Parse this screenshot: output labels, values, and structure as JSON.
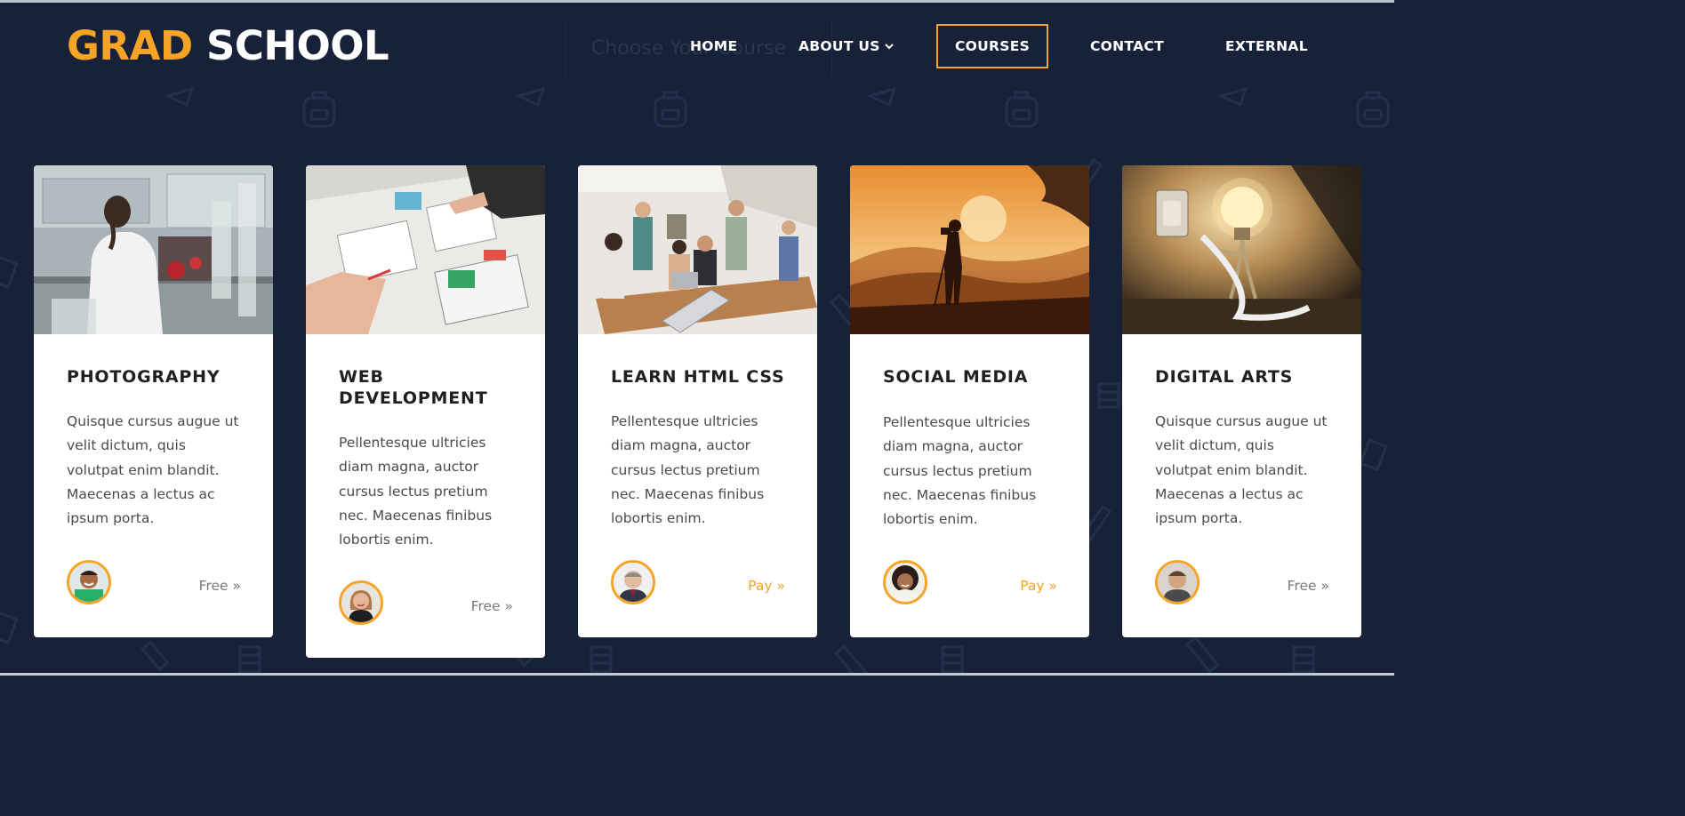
{
  "logo": {
    "accent": "GRAD",
    "rest": "SCHOOL"
  },
  "search": {
    "ghost_text": "Choose Your Course"
  },
  "nav": {
    "items": [
      {
        "label": "HOME",
        "active": false
      },
      {
        "label": "ABOUT US",
        "active": false,
        "dropdown": true
      },
      {
        "label": "COURSES",
        "active": true
      },
      {
        "label": "CONTACT",
        "active": false
      },
      {
        "label": "EXTERNAL",
        "active": false
      }
    ],
    "dropdown_icon": "chevron-down-icon"
  },
  "cards": [
    {
      "title": "PHOTOGRAPHY",
      "description": "Quisque cursus augue ut velit dictum, quis volutpat enim blandit. Maecenas a lectus ac ipsum porta.",
      "image": "lab-scientist-image",
      "avatar": "instructor-avatar",
      "price": "Free",
      "price_type": "free"
    },
    {
      "title": "WEB DEVELOPMENT",
      "description": "Pellentesque ultricies diam magna, auctor cursus lectus pretium nec. Maecenas finibus lobortis enim.",
      "image": "design-sketches-image",
      "avatar": "instructor-avatar",
      "price": "Free",
      "price_type": "free"
    },
    {
      "title": "LEARN HTML CSS",
      "description": "Pellentesque ultricies diam magna, auctor cursus lectus pretium nec. Maecenas finibus lobortis enim.",
      "image": "team-meeting-image",
      "avatar": "instructor-avatar",
      "price": "Pay",
      "price_type": "pay"
    },
    {
      "title": "SOCIAL MEDIA",
      "description": "Pellentesque ultricies diam magna, auctor cursus lectus pretium nec. Maecenas finibus lobortis enim.",
      "image": "sunset-photographer-image",
      "avatar": "instructor-avatar",
      "price": "Pay",
      "price_type": "pay"
    },
    {
      "title": "DIGITAL ARTS",
      "description": "Quisque cursus augue ut velit dictum, quis volutpat enim blandit. Maecenas a lectus ac ipsum porta.",
      "image": "lightbulb-figure-image",
      "avatar": "instructor-avatar",
      "price": "Free",
      "price_type": "free"
    }
  ],
  "price_arrow": "»",
  "colors": {
    "background": "#172239",
    "accent": "#f5a425",
    "card": "#ffffff",
    "title_text": "#1f1f1f",
    "body_text": "#4a4a4a",
    "free_text": "#7a7a7a"
  }
}
